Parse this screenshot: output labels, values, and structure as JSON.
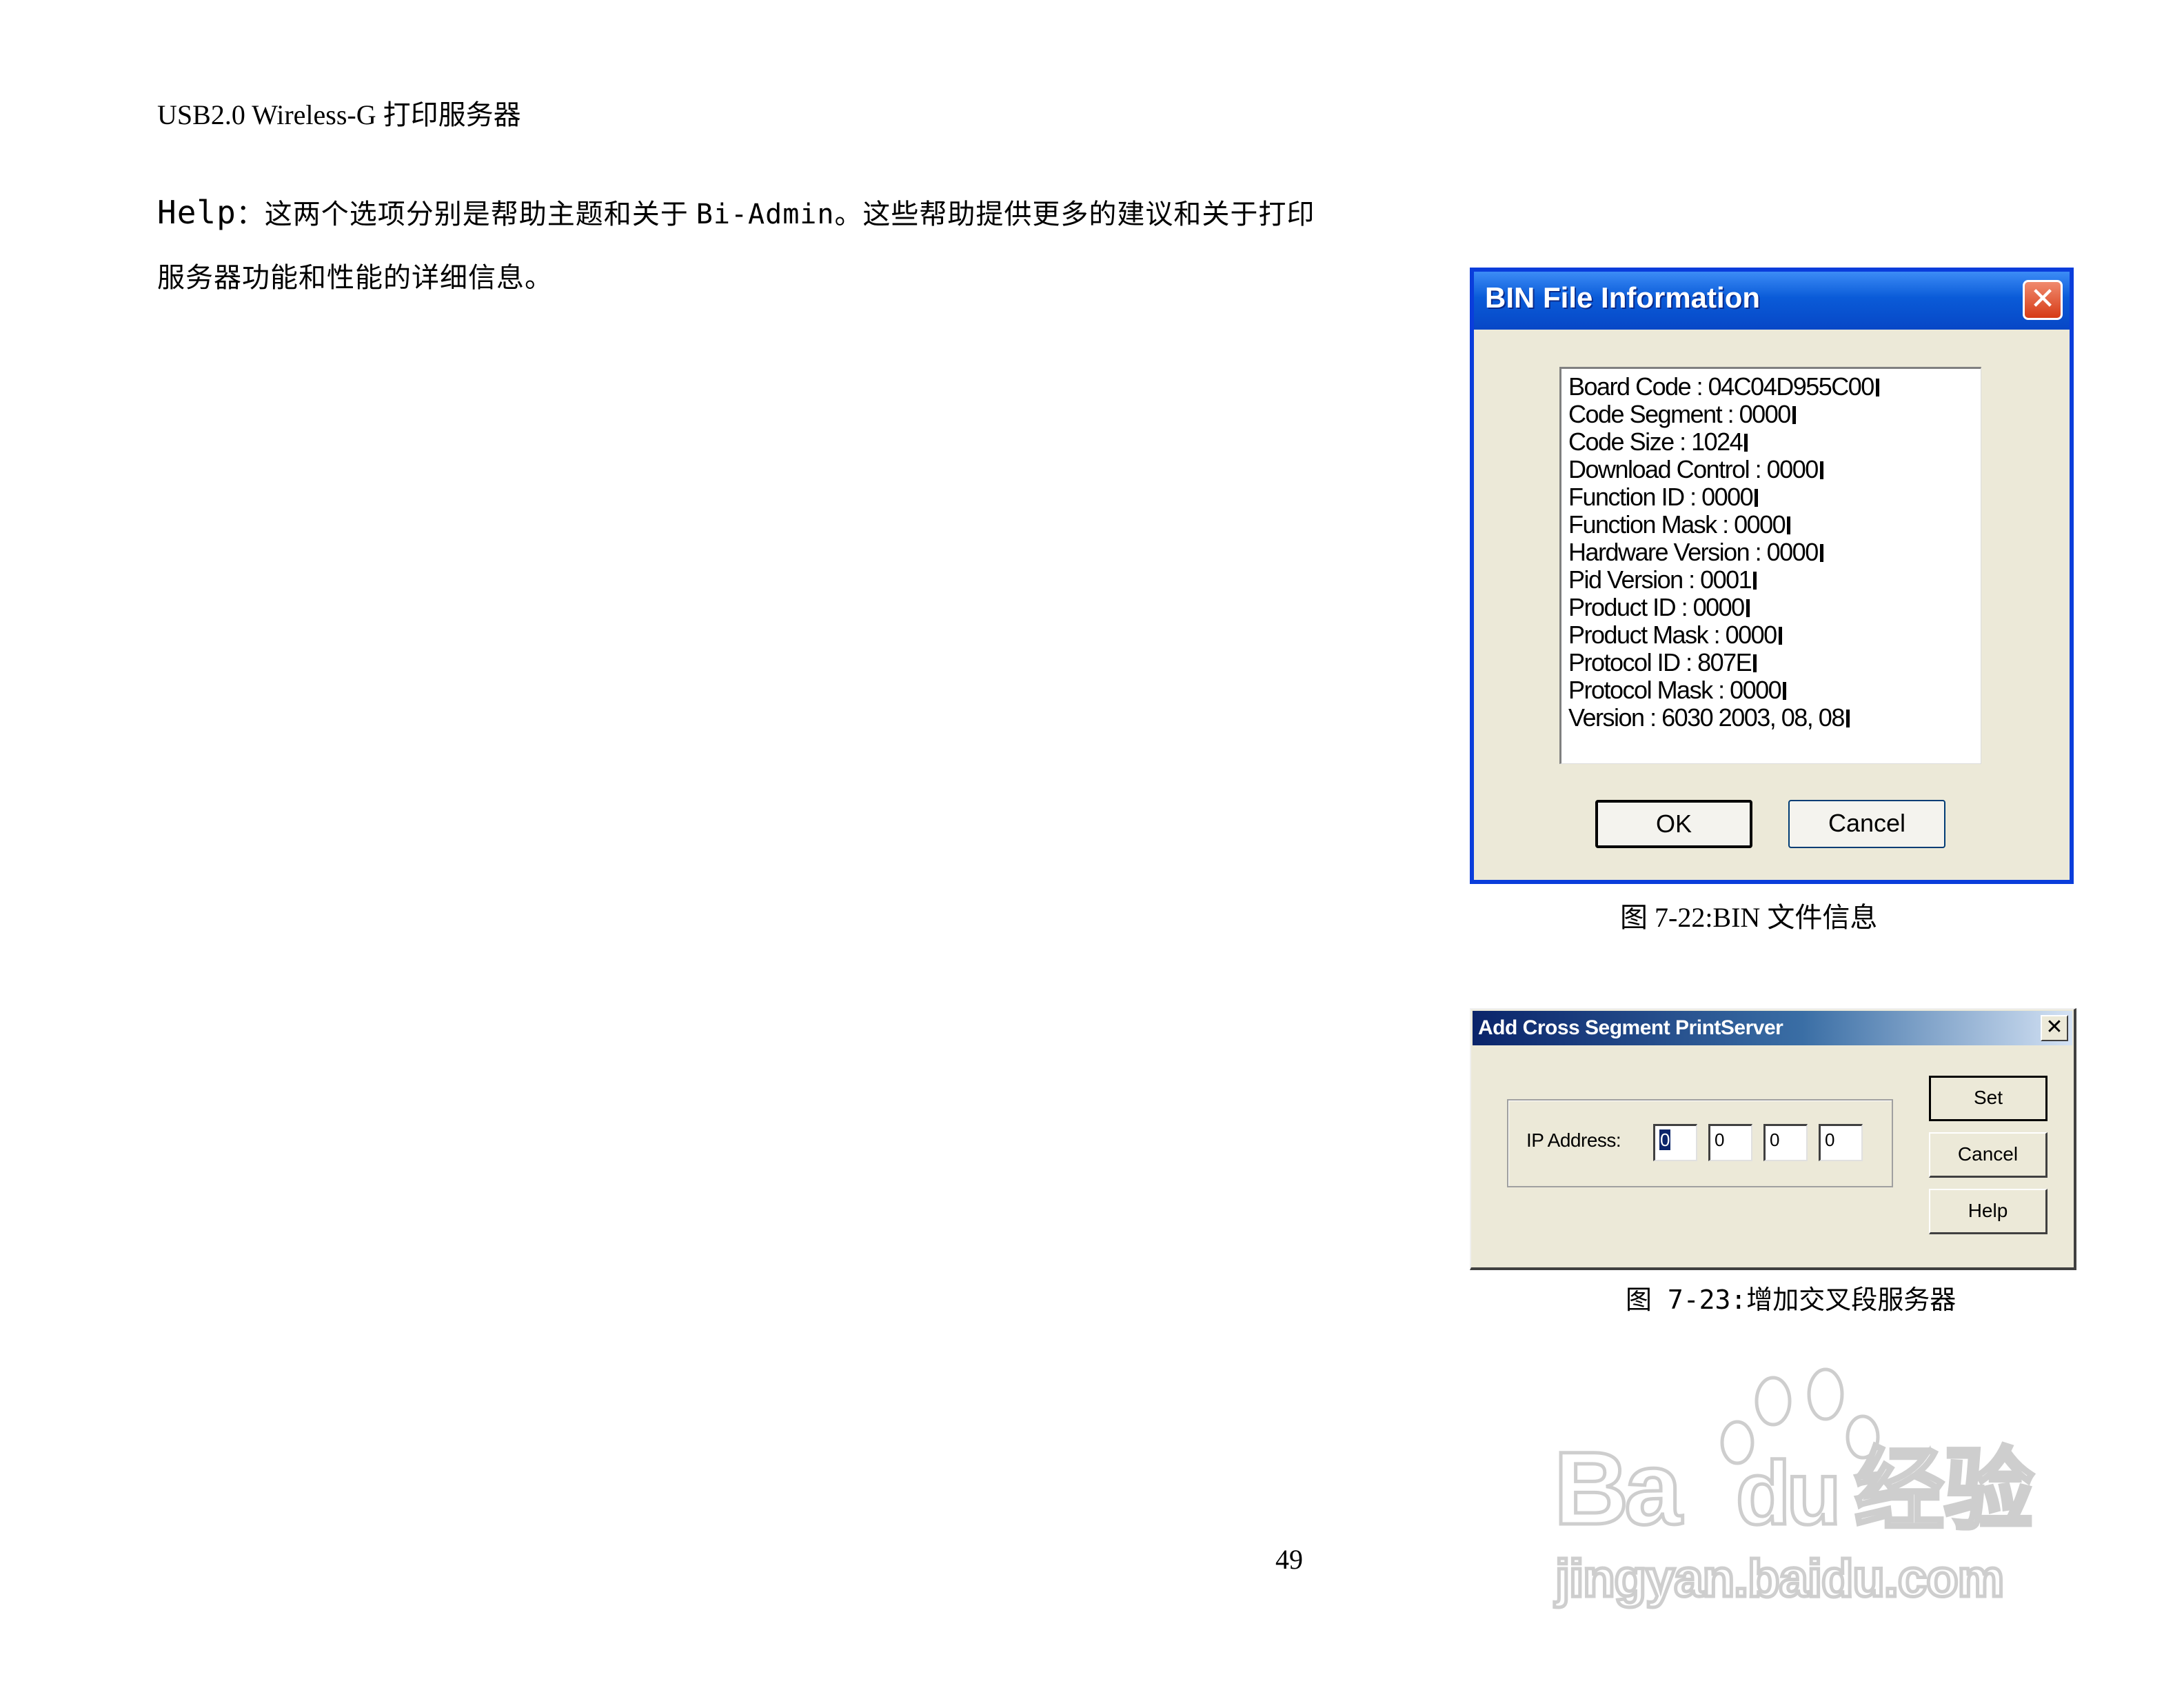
{
  "header": {
    "title": "USB2.0 Wireless-G 打印服务器"
  },
  "help_paragraph": {
    "term": "Help",
    "line1_a": "：这两个选项分别是帮助主题和关于 ",
    "line1_mono": "Bi-Admin",
    "line1_b": "。这些帮助提供更多的建议和关于打印",
    "line2": "服务器功能和性能的详细信息。"
  },
  "bin_dialog": {
    "title": "BIN File Information",
    "close_glyph": "✕",
    "rows": [
      "Board Code : 04C04D955C00",
      "Code Segment : 0000",
      "Code Size : 1024",
      "Download Control : 0000",
      "Function ID : 0000",
      "Function Mask : 0000",
      "Hardware Version : 0000",
      "Pid Version : 0001",
      "Product ID : 0000",
      "Product Mask : 0000",
      "Protocol ID : 807E",
      "Protocol Mask : 0000",
      "Version : 6030  2003, 08, 08"
    ],
    "ok_label": "OK",
    "cancel_label": "Cancel"
  },
  "caption1": "图 7-22:BIN 文件信息",
  "acs_dialog": {
    "title": "Add Cross Segment PrintServer",
    "close_glyph": "✕",
    "ip_label": "IP Address:",
    "octets": [
      "0",
      "0",
      "0",
      "0"
    ],
    "set_label": "Set",
    "cancel_label": "Cancel",
    "help_label": "Help"
  },
  "caption2": "图 7-23:增加交叉段服务器",
  "page_number": "49",
  "watermark": {
    "brand_a": "Ba",
    "brand_b": "du",
    "brand_cn": "经验",
    "url": "jingyan.baidu.com"
  }
}
